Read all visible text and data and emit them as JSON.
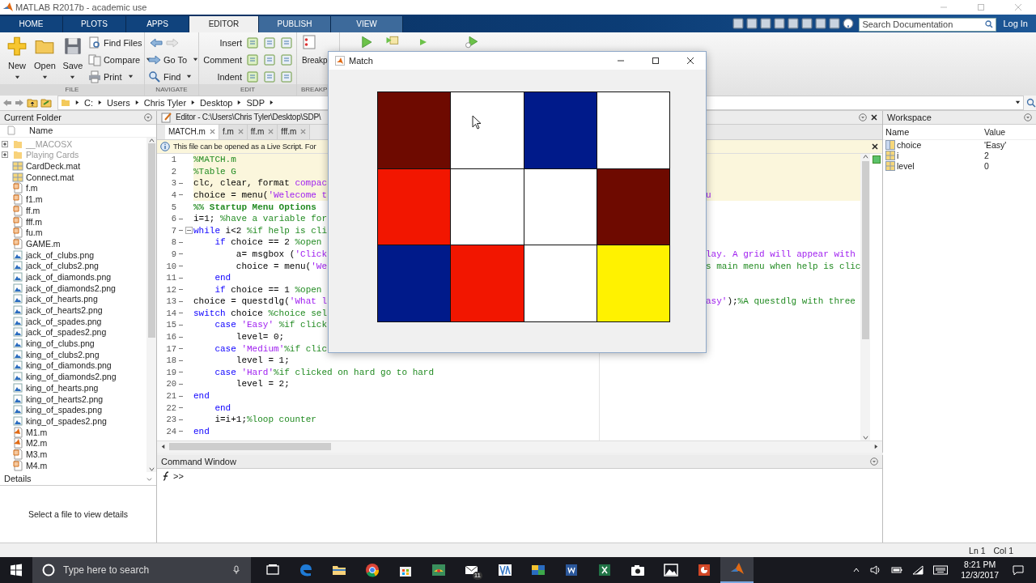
{
  "app_title": "MATLAB R2017b - academic use",
  "ribbon_tabs": [
    {
      "label": "HOME",
      "selected": false
    },
    {
      "label": "PLOTS",
      "selected": false
    },
    {
      "label": "APPS",
      "selected": false
    },
    {
      "label": "EDITOR",
      "selected": true
    },
    {
      "label": "PUBLISH",
      "selected": false
    },
    {
      "label": "VIEW",
      "selected": false
    }
  ],
  "search": {
    "placeholder": "Search Documentation"
  },
  "login": "Log In",
  "toolstrip": {
    "file": {
      "label": "FILE",
      "large": [
        "New",
        "Open",
        "Save"
      ],
      "small": [
        "Find Files",
        "Compare",
        "Print"
      ]
    },
    "navigate": {
      "label": "NAVIGATE",
      "items": [
        "Go To",
        "Find"
      ]
    },
    "edit": {
      "label": "EDIT",
      "items": [
        "Insert",
        "Comment",
        "Indent"
      ]
    },
    "breakpoints": {
      "label": "BREAKP",
      "button": "Breakp"
    }
  },
  "address": [
    "C:",
    "Users",
    "Chris Tyler",
    "Desktop",
    "SDP"
  ],
  "current_folder": {
    "title": "Current Folder",
    "column": "Name",
    "items": [
      {
        "name": "__MACOSX",
        "kind": "folder",
        "expanded": false
      },
      {
        "name": "Playing Cards",
        "kind": "folder",
        "expanded": false
      },
      {
        "name": "CardDeck.mat",
        "kind": "mat"
      },
      {
        "name": "Connect.mat",
        "kind": "mat"
      },
      {
        "name": "f.m",
        "kind": "function"
      },
      {
        "name": "f1.m",
        "kind": "function"
      },
      {
        "name": "ff.m",
        "kind": "function"
      },
      {
        "name": "fff.m",
        "kind": "function"
      },
      {
        "name": "fu.m",
        "kind": "function"
      },
      {
        "name": "GAME.m",
        "kind": "function"
      },
      {
        "name": "jack_of_clubs.png",
        "kind": "image"
      },
      {
        "name": "jack_of_clubs2.png",
        "kind": "image"
      },
      {
        "name": "jack_of_diamonds.png",
        "kind": "image"
      },
      {
        "name": "jack_of_diamonds2.png",
        "kind": "image"
      },
      {
        "name": "jack_of_hearts.png",
        "kind": "image"
      },
      {
        "name": "jack_of_hearts2.png",
        "kind": "image"
      },
      {
        "name": "jack_of_spades.png",
        "kind": "image"
      },
      {
        "name": "jack_of_spades2.png",
        "kind": "image"
      },
      {
        "name": "king_of_clubs.png",
        "kind": "image"
      },
      {
        "name": "king_of_clubs2.png",
        "kind": "image"
      },
      {
        "name": "king_of_diamonds.png",
        "kind": "image"
      },
      {
        "name": "king_of_diamonds2.png",
        "kind": "image"
      },
      {
        "name": "king_of_hearts.png",
        "kind": "image"
      },
      {
        "name": "king_of_hearts2.png",
        "kind": "image"
      },
      {
        "name": "king_of_spades.png",
        "kind": "image"
      },
      {
        "name": "king_of_spades2.png",
        "kind": "image"
      },
      {
        "name": "M1.m",
        "kind": "script"
      },
      {
        "name": "M2.m",
        "kind": "script"
      },
      {
        "name": "M3.m",
        "kind": "function"
      },
      {
        "name": "M4.m",
        "kind": "function"
      }
    ]
  },
  "details": {
    "title": "Details",
    "message": "Select a file to view details"
  },
  "editor": {
    "title": "Editor - C:\\Users\\Chris Tyler\\Desktop\\SDP\\",
    "tabs": [
      {
        "label": "MATCH.m",
        "selected": true
      },
      {
        "label": "f.m",
        "selected": false
      },
      {
        "label": "ff.m",
        "selected": false
      },
      {
        "label": "fff.m",
        "selected": false
      }
    ],
    "info": "This file can be opened as a Live Script. For",
    "lines": [
      {
        "num": "1",
        "exec": false,
        "cell": true,
        "segs": [
          {
            "kind": "comment",
            "text": "%MATCH.m"
          }
        ]
      },
      {
        "num": "2",
        "exec": false,
        "cell": true,
        "segs": [
          {
            "kind": "comment",
            "text": "%Table G"
          }
        ]
      },
      {
        "num": "3",
        "exec": true,
        "cell": true,
        "segs": [
          {
            "kind": "plain",
            "text": "clc, clear, format "
          },
          {
            "kind": "string",
            "text": "compac"
          }
        ]
      },
      {
        "num": "4",
        "exec": true,
        "cell": true,
        "segs": [
          {
            "kind": "plain",
            "text": "choice = menu("
          },
          {
            "kind": "string",
            "text": "'Welecome t"
          }
        ],
        "right": [
          {
            "kind": "string",
            "text": "u"
          }
        ]
      },
      {
        "num": "5",
        "exec": false,
        "cell": false,
        "segs": [
          {
            "kind": "section",
            "text": "%% Startup Menu Options"
          }
        ]
      },
      {
        "num": "6",
        "exec": true,
        "cell": false,
        "segs": [
          {
            "kind": "plain",
            "text": "i=1; "
          },
          {
            "kind": "comment",
            "text": "%have a variable for"
          }
        ]
      },
      {
        "num": "7",
        "exec": true,
        "cell": false,
        "fold": true,
        "segs": [
          {
            "kind": "keyword",
            "text": "while"
          },
          {
            "kind": "plain",
            "text": " i<2 "
          },
          {
            "kind": "comment",
            "text": "%if help is cli"
          }
        ]
      },
      {
        "num": "8",
        "exec": true,
        "cell": false,
        "segs": [
          {
            "kind": "keyword",
            "text": "    if"
          },
          {
            "kind": "plain",
            "text": " choice == 2 "
          },
          {
            "kind": "comment",
            "text": "%open"
          }
        ]
      },
      {
        "num": "9",
        "exec": true,
        "cell": false,
        "segs": [
          {
            "kind": "plain",
            "text": "        a= msgbox ("
          },
          {
            "kind": "string",
            "text": "'Click"
          }
        ],
        "right": [
          {
            "kind": "string",
            "text": "lay. A grid will appear with"
          }
        ]
      },
      {
        "num": "10",
        "exec": true,
        "cell": false,
        "segs": [
          {
            "kind": "plain",
            "text": "        choice = menu("
          },
          {
            "kind": "string",
            "text": "'We"
          }
        ],
        "right": [
          {
            "kind": "comment",
            "text": "s main menu when help is clic"
          }
        ]
      },
      {
        "num": "11",
        "exec": true,
        "cell": false,
        "segs": [
          {
            "kind": "keyword",
            "text": "    end"
          }
        ]
      },
      {
        "num": "12",
        "exec": true,
        "cell": false,
        "segs": [
          {
            "kind": "keyword",
            "text": "    if"
          },
          {
            "kind": "plain",
            "text": " choice == 1 "
          },
          {
            "kind": "comment",
            "text": "%open"
          }
        ]
      },
      {
        "num": "13",
        "exec": true,
        "cell": false,
        "segs": [
          {
            "kind": "plain",
            "text": "choice = questdlg("
          },
          {
            "kind": "string",
            "text": "'What l"
          }
        ],
        "right": [
          {
            "kind": "string",
            "text": "asy'"
          },
          {
            "kind": "plain",
            "text": ");"
          },
          {
            "kind": "comment",
            "text": "%A questdlg with three"
          }
        ]
      },
      {
        "num": "14",
        "exec": true,
        "cell": false,
        "segs": [
          {
            "kind": "keyword",
            "text": "switch"
          },
          {
            "kind": "plain",
            "text": " choice "
          },
          {
            "kind": "comment",
            "text": "%choice sel"
          }
        ]
      },
      {
        "num": "15",
        "exec": true,
        "cell": false,
        "segs": [
          {
            "kind": "keyword",
            "text": "    case "
          },
          {
            "kind": "string",
            "text": "'Easy'"
          },
          {
            "kind": "comment",
            "text": " %if click"
          }
        ]
      },
      {
        "num": "16",
        "exec": true,
        "cell": false,
        "segs": [
          {
            "kind": "plain",
            "text": "        level= 0;"
          }
        ]
      },
      {
        "num": "17",
        "exec": true,
        "cell": false,
        "segs": [
          {
            "kind": "keyword",
            "text": "    case "
          },
          {
            "kind": "string",
            "text": "'Medium'"
          },
          {
            "kind": "comment",
            "text": "%if clic"
          }
        ]
      },
      {
        "num": "18",
        "exec": true,
        "cell": false,
        "segs": [
          {
            "kind": "plain",
            "text": "        level = 1;"
          }
        ]
      },
      {
        "num": "19",
        "exec": true,
        "cell": false,
        "segs": [
          {
            "kind": "keyword",
            "text": "    case "
          },
          {
            "kind": "string",
            "text": "'Hard'"
          },
          {
            "kind": "comment",
            "text": "%if clicked on hard go to hard"
          }
        ]
      },
      {
        "num": "20",
        "exec": true,
        "cell": false,
        "segs": [
          {
            "kind": "plain",
            "text": "        level = 2;"
          }
        ]
      },
      {
        "num": "21",
        "exec": true,
        "cell": false,
        "segs": [
          {
            "kind": "keyword",
            "text": "end"
          }
        ]
      },
      {
        "num": "22",
        "exec": true,
        "cell": false,
        "segs": [
          {
            "kind": "keyword",
            "text": "    end"
          }
        ]
      },
      {
        "num": "23",
        "exec": true,
        "cell": false,
        "segs": [
          {
            "kind": "plain",
            "text": "    i=i+1;"
          },
          {
            "kind": "comment",
            "text": "%loop counter"
          }
        ]
      },
      {
        "num": "24",
        "exec": true,
        "cell": false,
        "segs": [
          {
            "kind": "keyword",
            "text": "end"
          }
        ]
      }
    ]
  },
  "command_window": {
    "title": "Command Window",
    "prompt": ">>"
  },
  "workspace": {
    "title": "Workspace",
    "columns": [
      "Name",
      "Value"
    ],
    "vars": [
      {
        "name": "choice",
        "value": "'Easy'",
        "kind": "char"
      },
      {
        "name": "i",
        "value": "2",
        "kind": "numeric"
      },
      {
        "name": "level",
        "value": "0",
        "kind": "numeric"
      }
    ]
  },
  "match_window": {
    "title": "Match",
    "cells": [
      {
        "color": "#6e0a00"
      },
      {
        "color": "#ffffff"
      },
      {
        "color": "#001a8a"
      },
      {
        "color": "#ffffff"
      },
      {
        "color": "#f21600"
      },
      {
        "color": "#ffffff"
      },
      {
        "color": "#ffffff"
      },
      {
        "color": "#6e0a00"
      },
      {
        "color": "#001a8a"
      },
      {
        "color": "#f21600"
      },
      {
        "color": "#ffffff"
      },
      {
        "color": "#fff200"
      }
    ]
  },
  "status": {
    "line": "Ln 1",
    "col": "Col 1"
  },
  "taskbar": {
    "search_placeholder": "Type here to search",
    "apps": [
      {
        "kind": "taskview",
        "selected": false
      },
      {
        "kind": "edge",
        "selected": false
      },
      {
        "kind": "explorer",
        "selected": false
      },
      {
        "kind": "chrome",
        "selected": false
      },
      {
        "kind": "store",
        "selected": false
      },
      {
        "kind": "game",
        "selected": false
      },
      {
        "kind": "mail",
        "selected": false,
        "badge": "11"
      },
      {
        "kind": "va",
        "selected": false
      },
      {
        "kind": "ms",
        "selected": false
      },
      {
        "kind": "word",
        "selected": false
      },
      {
        "kind": "excel",
        "selected": false
      },
      {
        "kind": "camera",
        "selected": false
      },
      {
        "kind": "photos",
        "selected": false
      },
      {
        "kind": "powerpoint",
        "selected": false
      },
      {
        "kind": "matlab",
        "selected": true
      }
    ],
    "time": "8:21 PM",
    "date": "12/3/2017"
  }
}
